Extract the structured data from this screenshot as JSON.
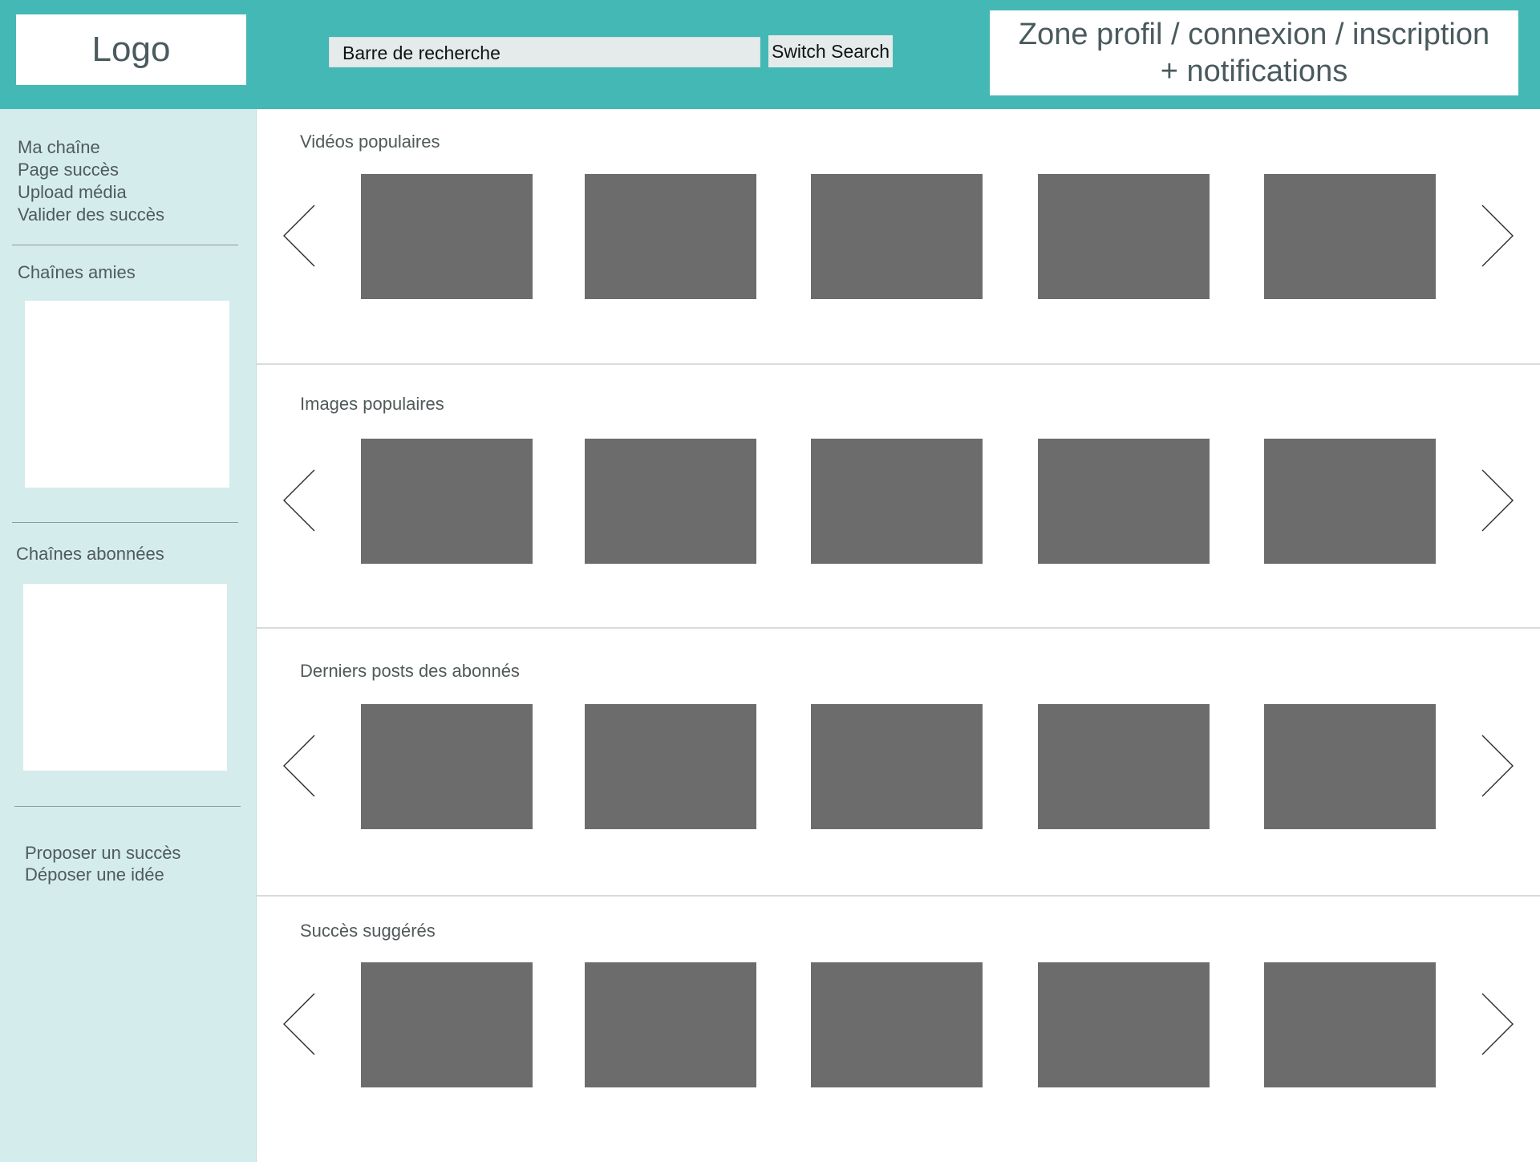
{
  "header": {
    "logo": "Logo",
    "search_placeholder": "Barre de recherche",
    "switch_search": "Switch Search",
    "profile_zone_line1": "Zone profil / connexion / inscription",
    "profile_zone_line2": "+ notifications"
  },
  "sidebar": {
    "links": [
      "Ma chaîne",
      "Page succès",
      "Upload média",
      "Valider des succès"
    ],
    "friends_title": "Chaînes amies",
    "subscribed_title": "Chaînes abonnées",
    "bottom_links": [
      "Proposer un succès",
      "Déposer une idée"
    ]
  },
  "sections": [
    {
      "title": "Vidéos populaires",
      "item_count": 5
    },
    {
      "title": "Images populaires",
      "item_count": 5
    },
    {
      "title": "Derniers posts des abonnés",
      "item_count": 5
    },
    {
      "title": "Succès suggérés",
      "item_count": 5
    }
  ],
  "icons": {
    "prev": "chevron-left-icon",
    "next": "chevron-right-icon"
  },
  "colors": {
    "header_bg": "#44b8b5",
    "sidebar_bg": "#d4ecec",
    "thumbnail": "#6d6c6d",
    "text": "#505a5a"
  }
}
